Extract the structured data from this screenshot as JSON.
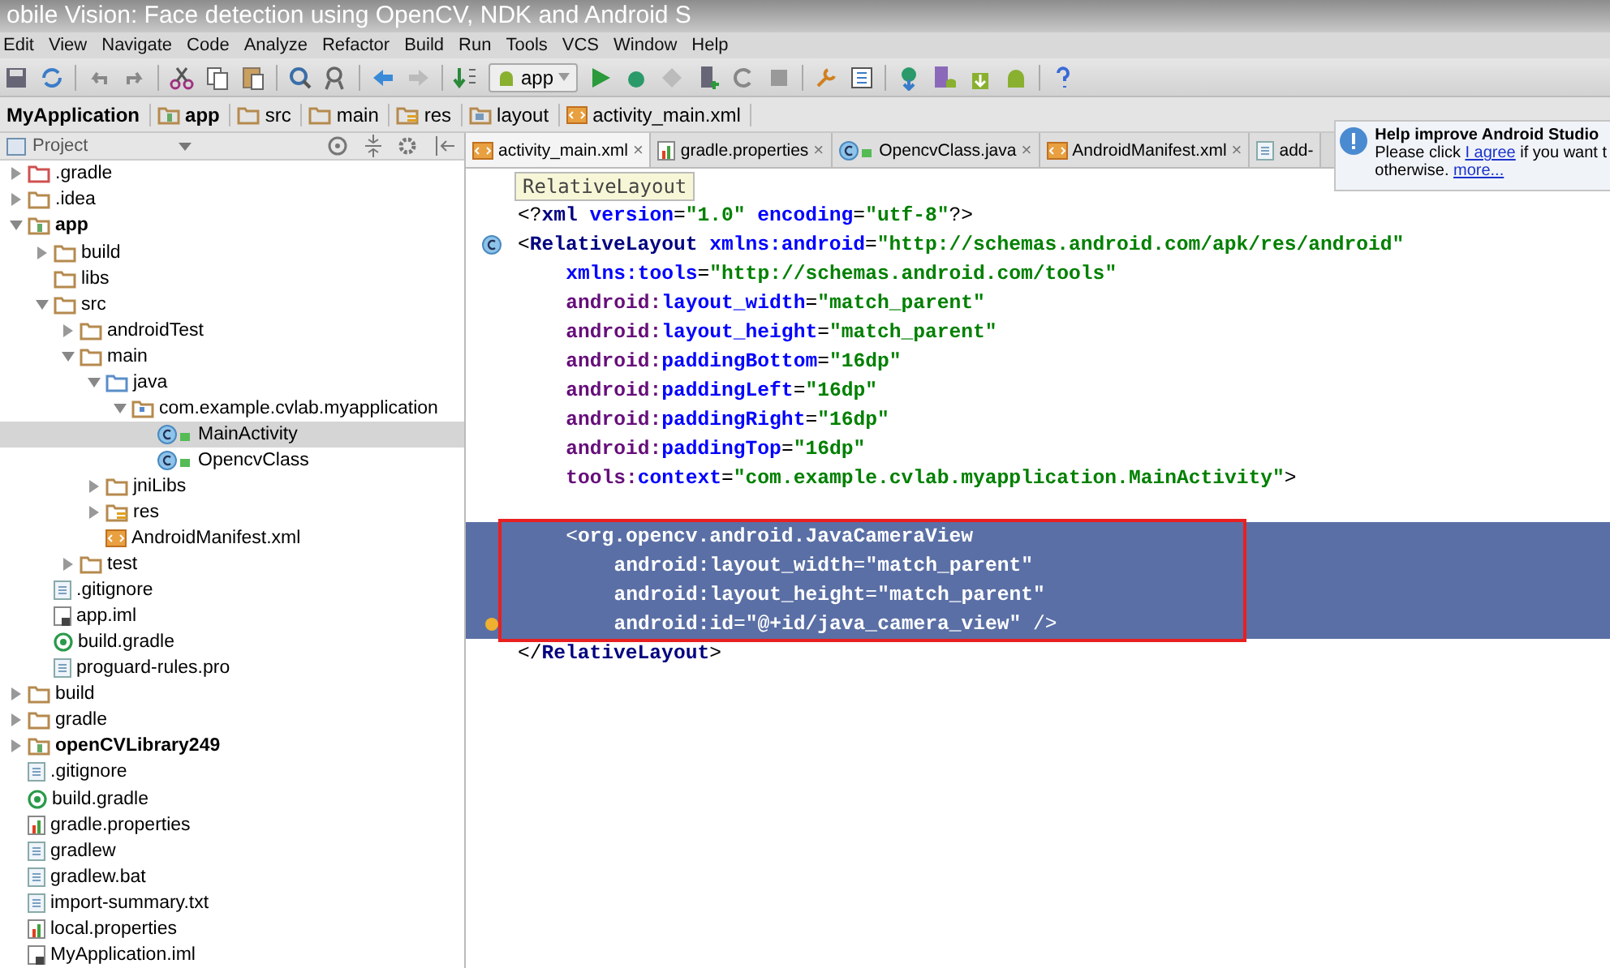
{
  "video_title": "obile Vision: Face detection using OpenCV, NDK and Android S",
  "menu": [
    "Edit",
    "View",
    "Navigate",
    "Code",
    "Analyze",
    "Refactor",
    "Build",
    "Run",
    "Tools",
    "VCS",
    "Window",
    "Help"
  ],
  "run_config": "app",
  "breadcrumb": [
    {
      "label": "MyApplication",
      "kind": "project"
    },
    {
      "label": "app",
      "kind": "module"
    },
    {
      "label": "src",
      "kind": "folder"
    },
    {
      "label": "main",
      "kind": "folder"
    },
    {
      "label": "res",
      "kind": "res"
    },
    {
      "label": "layout",
      "kind": "layout"
    },
    {
      "label": "activity_main.xml",
      "kind": "xml"
    }
  ],
  "project_panel": {
    "title": "Project"
  },
  "tree": [
    {
      "name": ".gradle",
      "kind": "folder-excluded",
      "expanded": false,
      "selected": false
    },
    {
      "name": ".idea",
      "kind": "folder",
      "expanded": false,
      "selected": false
    },
    {
      "name": "app",
      "kind": "module",
      "bold": true,
      "expanded": true,
      "selected": false,
      "children": [
        {
          "name": "build",
          "kind": "folder",
          "expanded": false,
          "selected": false
        },
        {
          "name": "libs",
          "kind": "folder",
          "selected": false
        },
        {
          "name": "src",
          "kind": "folder",
          "expanded": true,
          "selected": false,
          "children": [
            {
              "name": "androidTest",
              "kind": "folder",
              "expanded": false,
              "selected": false
            },
            {
              "name": "main",
              "kind": "folder",
              "expanded": true,
              "selected": false,
              "children": [
                {
                  "name": "java",
                  "kind": "source",
                  "expanded": true,
                  "selected": false,
                  "children": [
                    {
                      "name": "com.example.cvlab.myapplication",
                      "kind": "package",
                      "expanded": true,
                      "selected": false,
                      "children": [
                        {
                          "name": "MainActivity",
                          "kind": "class",
                          "selected": true
                        },
                        {
                          "name": "OpencvClass",
                          "kind": "class",
                          "selected": false
                        }
                      ]
                    }
                  ]
                },
                {
                  "name": "jniLibs",
                  "kind": "folder",
                  "expanded": false,
                  "selected": false
                },
                {
                  "name": "res",
                  "kind": "res",
                  "expanded": false,
                  "selected": false
                },
                {
                  "name": "AndroidManifest.xml",
                  "kind": "xml",
                  "selected": false
                }
              ]
            },
            {
              "name": "test",
              "kind": "folder",
              "expanded": false,
              "selected": false
            }
          ]
        },
        {
          "name": ".gitignore",
          "kind": "text",
          "selected": false
        },
        {
          "name": "app.iml",
          "kind": "iml",
          "selected": false
        },
        {
          "name": "build.gradle",
          "kind": "gradle",
          "selected": false
        },
        {
          "name": "proguard-rules.pro",
          "kind": "text",
          "selected": false
        }
      ]
    },
    {
      "name": "build",
      "kind": "folder",
      "expanded": false,
      "selected": false
    },
    {
      "name": "gradle",
      "kind": "folder",
      "expanded": false,
      "selected": false
    },
    {
      "name": "openCVLibrary249",
      "kind": "module",
      "bold": true,
      "expanded": false,
      "selected": false
    },
    {
      "name": ".gitignore",
      "kind": "text",
      "selected": false
    },
    {
      "name": "build.gradle",
      "kind": "gradle",
      "selected": false
    },
    {
      "name": "gradle.properties",
      "kind": "properties",
      "selected": false
    },
    {
      "name": "gradlew",
      "kind": "text",
      "selected": false
    },
    {
      "name": "gradlew.bat",
      "kind": "text",
      "selected": false
    },
    {
      "name": "import-summary.txt",
      "kind": "text",
      "selected": false
    },
    {
      "name": "local.properties",
      "kind": "properties",
      "selected": false
    },
    {
      "name": "MyApplication.iml",
      "kind": "iml",
      "selected": false
    }
  ],
  "tabs": [
    {
      "label": "activity_main.xml",
      "kind": "xml",
      "selected": true,
      "close": "×"
    },
    {
      "label": "gradle.properties",
      "kind": "properties",
      "selected": false,
      "close": "×"
    },
    {
      "label": "OpencvClass.java",
      "kind": "class",
      "selected": false,
      "close": "×"
    },
    {
      "label": "AndroidManifest.xml",
      "kind": "xml",
      "selected": false,
      "close": "×"
    },
    {
      "label": "add-",
      "kind": "text",
      "selected": false
    }
  ],
  "breadcrumb_tooltip": "RelativeLayout",
  "code": [
    {
      "selected": false,
      "segments": [
        {
          "kind": "plain",
          "text": "<?"
        },
        {
          "kind": "tag",
          "text": "xml "
        },
        {
          "kind": "attr",
          "text": "version"
        },
        {
          "kind": "plain",
          "text": "="
        },
        {
          "kind": "value",
          "text": "\"1.0\" "
        },
        {
          "kind": "attr",
          "text": "encoding"
        },
        {
          "kind": "plain",
          "text": "="
        },
        {
          "kind": "value",
          "text": "\"utf-8\""
        },
        {
          "kind": "plain",
          "text": "?>"
        }
      ]
    },
    {
      "selected": false,
      "class_marker": true,
      "segments": [
        {
          "kind": "plain",
          "text": "<"
        },
        {
          "kind": "tag",
          "text": "RelativeLayout "
        },
        {
          "kind": "attr",
          "text": "xmlns:android"
        },
        {
          "kind": "plain",
          "text": "="
        },
        {
          "kind": "value",
          "text": "\"http://schemas.android.com/apk/res/android\""
        }
      ],
      "children": [
        {
          "selected": false,
          "segments": [
            {
              "kind": "attr",
              "text": "xmlns:tools"
            },
            {
              "kind": "plain",
              "text": "="
            },
            {
              "kind": "value",
              "text": "\"http://schemas.android.com/tools\""
            }
          ]
        },
        {
          "selected": false,
          "segments": [
            {
              "kind": "ns",
              "text": "android:"
            },
            {
              "kind": "attr",
              "text": "layout_width"
            },
            {
              "kind": "plain",
              "text": "="
            },
            {
              "kind": "value",
              "text": "\"match_parent\""
            }
          ]
        },
        {
          "selected": false,
          "segments": [
            {
              "kind": "ns",
              "text": "android:"
            },
            {
              "kind": "attr",
              "text": "layout_height"
            },
            {
              "kind": "plain",
              "text": "="
            },
            {
              "kind": "value",
              "text": "\"match_parent\""
            }
          ]
        },
        {
          "selected": false,
          "segments": [
            {
              "kind": "ns",
              "text": "android:"
            },
            {
              "kind": "attr",
              "text": "paddingBottom"
            },
            {
              "kind": "plain",
              "text": "="
            },
            {
              "kind": "value",
              "text": "\"16dp\""
            }
          ]
        },
        {
          "selected": false,
          "segments": [
            {
              "kind": "ns",
              "text": "android:"
            },
            {
              "kind": "attr",
              "text": "paddingLeft"
            },
            {
              "kind": "plain",
              "text": "="
            },
            {
              "kind": "value",
              "text": "\"16dp\""
            }
          ]
        },
        {
          "selected": false,
          "segments": [
            {
              "kind": "ns",
              "text": "android:"
            },
            {
              "kind": "attr",
              "text": "paddingRight"
            },
            {
              "kind": "plain",
              "text": "="
            },
            {
              "kind": "value",
              "text": "\"16dp\""
            }
          ]
        },
        {
          "selected": false,
          "segments": [
            {
              "kind": "ns",
              "text": "android:"
            },
            {
              "kind": "attr",
              "text": "paddingTop"
            },
            {
              "kind": "plain",
              "text": "="
            },
            {
              "kind": "value",
              "text": "\"16dp\""
            }
          ]
        },
        {
          "selected": false,
          "segments": [
            {
              "kind": "ns",
              "text": "tools:"
            },
            {
              "kind": "attr",
              "text": "context"
            },
            {
              "kind": "plain",
              "text": "="
            },
            {
              "kind": "value",
              "text": "\"com.example.cvlab.myapplication.MainActivity\""
            },
            {
              "kind": "plain",
              "text": ">"
            }
          ]
        },
        {
          "selected": false
        },
        {
          "selected": true,
          "segments": [
            {
              "kind": "plain",
              "text": "<"
            },
            {
              "kind": "tag",
              "text": "org.opencv.android.JavaCameraView"
            }
          ],
          "children": [
            {
              "selected": true,
              "segments": [
                {
                  "kind": "ns",
                  "text": "android:"
                },
                {
                  "kind": "attr",
                  "text": "layout_width"
                },
                {
                  "kind": "plain",
                  "text": "="
                },
                {
                  "kind": "value",
                  "text": "\"match_parent\""
                }
              ]
            },
            {
              "selected": true,
              "segments": [
                {
                  "kind": "ns",
                  "text": "android:"
                },
                {
                  "kind": "attr",
                  "text": "layout_height"
                },
                {
                  "kind": "plain",
                  "text": "="
                },
                {
                  "kind": "value",
                  "text": "\"match_parent\""
                }
              ]
            },
            {
              "selected": true,
              "bulb": true,
              "segments": [
                {
                  "kind": "ns",
                  "text": "android:"
                },
                {
                  "kind": "attr",
                  "text": "id"
                },
                {
                  "kind": "plain",
                  "text": "="
                },
                {
                  "kind": "value",
                  "text": "\"@+id/java_camera_view\""
                },
                {
                  "kind": "plain",
                  "text": " />"
                }
              ]
            }
          ]
        }
      ]
    },
    {
      "selected": false,
      "segments": [
        {
          "kind": "plain",
          "text": "</"
        },
        {
          "kind": "tag",
          "text": "RelativeLayout"
        },
        {
          "kind": "plain",
          "text": ">"
        }
      ]
    }
  ],
  "notification": {
    "title": "Help improve Android Studio",
    "line1_before": "Please click ",
    "link1": "I agree",
    "line1_after": " if you want t",
    "line2_before": "otherwise. ",
    "link2": "more..."
  }
}
